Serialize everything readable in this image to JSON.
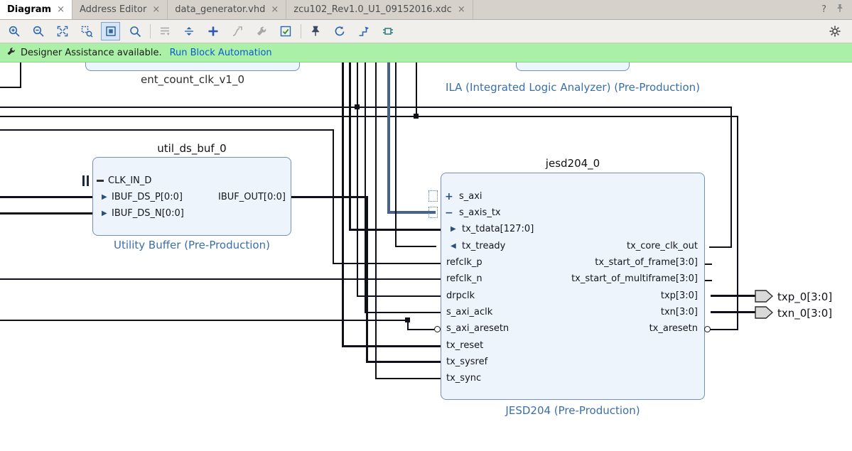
{
  "tab_bar": {
    "tabs": [
      {
        "label": "Diagram",
        "close": "×"
      },
      {
        "label": "Address Editor",
        "close": "×"
      },
      {
        "label": "data_generator.vhd",
        "close": "×"
      },
      {
        "label": "zcu102_Rev1.0_U1_09152016.xdc",
        "close": "×"
      }
    ],
    "help": "?"
  },
  "toolbar": {
    "icons": [
      {
        "name": "zoom-in"
      },
      {
        "name": "zoom-out"
      },
      {
        "name": "zoom-fit"
      },
      {
        "name": "zoom-to-selected"
      },
      {
        "name": "autofit-selection",
        "state": "selected"
      },
      {
        "name": "find"
      },
      {
        "name": "collapse-hierarchy",
        "state": "disabled"
      },
      {
        "name": "expand-hierarchy"
      },
      {
        "name": "add-ip"
      },
      {
        "name": "run-connection-automation",
        "state": "disabled"
      },
      {
        "name": "customize-block",
        "state": "disabled"
      },
      {
        "name": "validate-design"
      },
      {
        "name": "pin-selection"
      },
      {
        "name": "regenerate-layout"
      },
      {
        "name": "optimize-routing"
      },
      {
        "name": "expand-interfaces"
      },
      {
        "name": "settings"
      }
    ]
  },
  "banner": {
    "message": "Designer Assistance available.",
    "link": "Run Block Automation"
  },
  "diagram": {
    "fragments": {
      "ent_count": {
        "label": "ent_count_clk_v1_0"
      },
      "ila": {
        "label": "ILA (Integrated Logic Analyzer) (Pre-Production)"
      }
    },
    "util_ds_buf": {
      "title": "util_ds_buf_0",
      "subtitle": "Utility Buffer (Pre-Production)",
      "ports_left": [
        {
          "name": "CLK_IN_D"
        },
        {
          "name": "IBUF_DS_P[0:0]",
          "glyph": "▶"
        },
        {
          "name": "IBUF_DS_N[0:0]",
          "glyph": "▶"
        }
      ],
      "ports_right": [
        {
          "name": "IBUF_OUT[0:0]"
        }
      ]
    },
    "jesd204": {
      "title": "jesd204_0",
      "subtitle": "JESD204 (Pre-Production)",
      "ports_left": [
        {
          "name": "s_axi",
          "glyph": "+"
        },
        {
          "name": "s_axis_tx",
          "glyph": "−"
        },
        {
          "name": "tx_tdata[127:0]",
          "glyph": "▶"
        },
        {
          "name": "tx_tready",
          "glyph": "◀"
        },
        {
          "name": "refclk_p"
        },
        {
          "name": "refclk_n"
        },
        {
          "name": "drpclk"
        },
        {
          "name": "s_axi_aclk"
        },
        {
          "name": "s_axi_aresetn"
        },
        {
          "name": "tx_reset"
        },
        {
          "name": "tx_sysref"
        },
        {
          "name": "tx_sync"
        }
      ],
      "ports_right": [
        {
          "name": "tx_core_clk_out"
        },
        {
          "name": "tx_start_of_frame[3:0]"
        },
        {
          "name": "tx_start_of_multiframe[3:0]"
        },
        {
          "name": "txp[3:0]"
        },
        {
          "name": "txn[3:0]"
        },
        {
          "name": "tx_aresetn"
        }
      ]
    },
    "external_ports": [
      {
        "label": "txp_0[3:0]"
      },
      {
        "label": "txn_0[3:0]"
      }
    ],
    "colors": {
      "block_fill": "#edf4fc",
      "block_border": "#7191b5",
      "subtitle_text": "#3a6fa8",
      "wire": "#10101a",
      "wire_highlight": "#46628e",
      "banner_bg": "#aaf0a6",
      "link": "#0a5bd3"
    }
  }
}
